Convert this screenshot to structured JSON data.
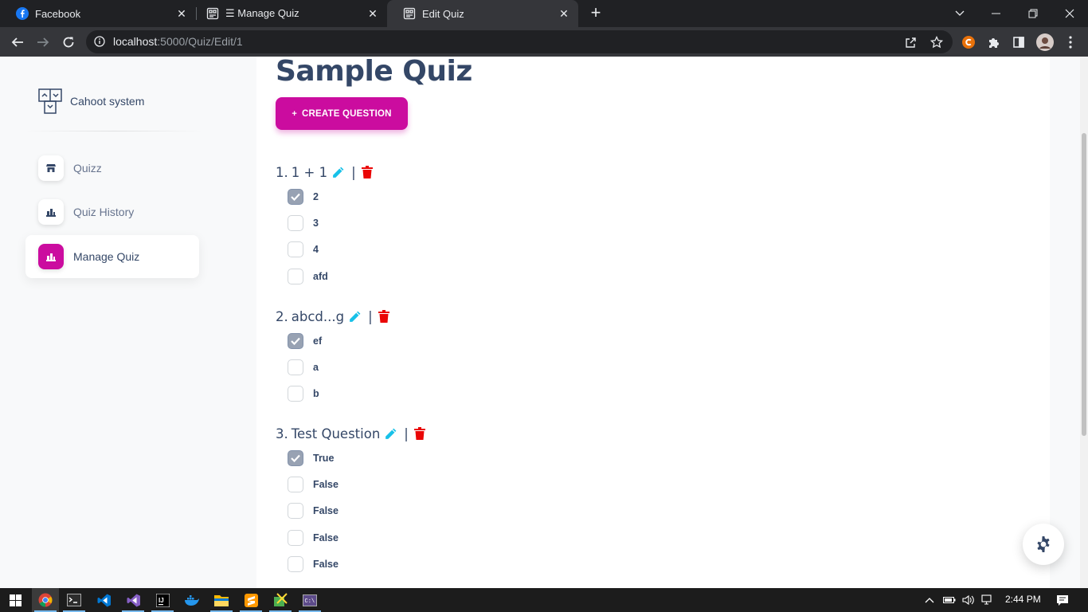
{
  "browser": {
    "tabs": [
      {
        "title": "Facebook",
        "icon": "facebook-icon",
        "active": false
      },
      {
        "title": "☰ Manage Quiz",
        "icon": "app-favicon",
        "active": false
      },
      {
        "title": "Edit Quiz",
        "icon": "app-favicon",
        "active": true
      }
    ],
    "url_host": "localhost",
    "url_path": ":5000/Quiz/Edit/1"
  },
  "sidebar": {
    "brand": "Cahoot system",
    "items": [
      {
        "label": "Quizz",
        "icon": "shop-icon",
        "active": false
      },
      {
        "label": "Quiz History",
        "icon": "chart-icon",
        "active": false
      },
      {
        "label": "Manage Quiz",
        "icon": "chart-icon",
        "active": true
      }
    ]
  },
  "main": {
    "title": "Sample Quiz",
    "create_button": "CREATE QUESTION",
    "questions": [
      {
        "number": "1.",
        "text": "1 + 1",
        "answers": [
          {
            "label": "2",
            "checked": true
          },
          {
            "label": "3",
            "checked": false
          },
          {
            "label": "4",
            "checked": false
          },
          {
            "label": "afd",
            "checked": false
          }
        ]
      },
      {
        "number": "2.",
        "text": "abcd...g",
        "answers": [
          {
            "label": "ef",
            "checked": true
          },
          {
            "label": "a",
            "checked": false
          },
          {
            "label": "b",
            "checked": false
          }
        ]
      },
      {
        "number": "3.",
        "text": "Test Question",
        "answers": [
          {
            "label": "True",
            "checked": true
          },
          {
            "label": "False",
            "checked": false
          },
          {
            "label": "False",
            "checked": false
          },
          {
            "label": "False",
            "checked": false
          },
          {
            "label": "False",
            "checked": false
          }
        ]
      }
    ]
  },
  "colors": {
    "accent": "#cb0c9f",
    "heading": "#344767",
    "edit_icon": "#17c1e8",
    "delete_icon": "#ea0606"
  },
  "taskbar": {
    "time": "2:44 PM"
  }
}
